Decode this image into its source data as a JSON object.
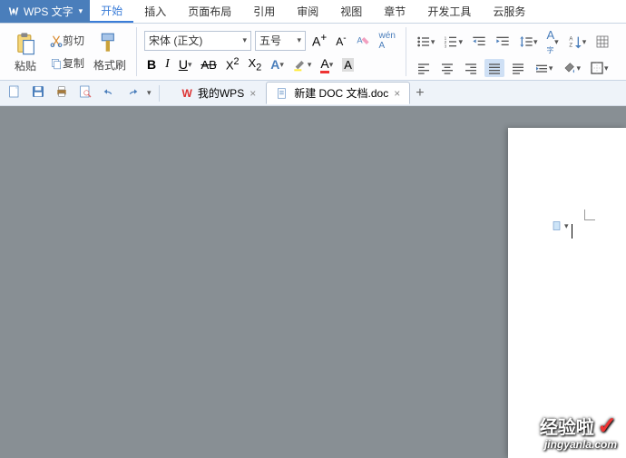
{
  "app": {
    "name": "WPS 文字"
  },
  "menu": {
    "items": [
      "开始",
      "插入",
      "页面布局",
      "引用",
      "审阅",
      "视图",
      "章节",
      "开发工具",
      "云服务"
    ],
    "active_index": 0
  },
  "ribbon": {
    "paste": "粘贴",
    "cut": "剪切",
    "copy": "复制",
    "format_painter": "格式刷",
    "font_name": "宋体 (正文)",
    "font_size": "五号"
  },
  "tabs": {
    "items": [
      {
        "label": "我的WPS",
        "active": false,
        "logo": "W"
      },
      {
        "label": "新建 DOC 文档.doc",
        "active": true,
        "logo": "doc"
      }
    ]
  },
  "watermark": {
    "cn": "经验啦",
    "en": "jingyanla.com",
    "check": "✓"
  }
}
